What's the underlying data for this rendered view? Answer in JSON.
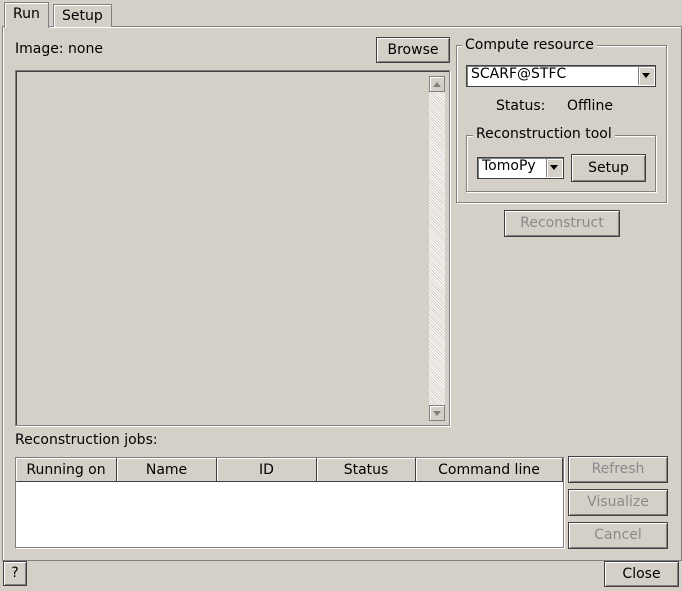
{
  "tabs": [
    {
      "label": "Run",
      "active": true
    },
    {
      "label": "Setup",
      "active": false
    }
  ],
  "image": {
    "label": "Image:",
    "value": "none",
    "browse_label": "Browse"
  },
  "compute": {
    "group_title": "Compute resource",
    "selected": "SCARF@STFC",
    "status_label": "Status:",
    "status_value": "Offline"
  },
  "tool": {
    "group_title": "Reconstruction tool",
    "selected": "TomoPy",
    "setup_label": "Setup"
  },
  "reconstruct_label": "Reconstruct",
  "jobs": {
    "label": "Reconstruction jobs:",
    "columns": [
      "Running on",
      "Name",
      "ID",
      "Status",
      "Command line"
    ],
    "rows": []
  },
  "job_actions": {
    "refresh_label": "Refresh",
    "visualize_label": "Visualize",
    "cancel_label": "Cancel"
  },
  "footer": {
    "help_label": "?",
    "close_label": "Close"
  }
}
